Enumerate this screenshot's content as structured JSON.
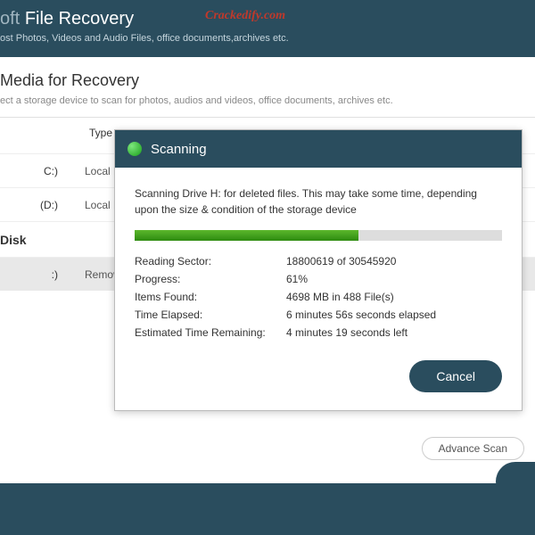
{
  "header": {
    "soft": "oft",
    "title": "File Recovery",
    "sub": "ost Photos, Videos and Audio Files, office documents,archives etc.",
    "watermark": "Crackedify.com"
  },
  "section": {
    "title": "Media for Recovery",
    "sub": "ect a storage device to scan for photos, audios and videos, office documents, archives etc."
  },
  "columns": {
    "type": "Type"
  },
  "drives": {
    "c_letter": "C:)",
    "c_type": "Local Disk",
    "d_letter": " (D:)",
    "d_type": "Local Disk",
    "group": "Disk",
    "h_letter": ":)",
    "h_type": "Removable"
  },
  "modal": {
    "title": "Scanning",
    "desc": "Scanning Drive H: for deleted files. This may take some time, depending upon the size & condition of the storage device",
    "progress_percent": 61,
    "stats": {
      "sector_label": "Reading Sector:",
      "sector_value": "18800619 of 30545920",
      "progress_label": "Progress:",
      "progress_value": "61%",
      "items_label": "Items Found:",
      "items_value": "4698 MB in 488 File(s)",
      "elapsed_label": "Time Elapsed:",
      "elapsed_value": "6 minutes 56s seconds elapsed",
      "remaining_label": "Estimated Time Remaining:",
      "remaining_value": "4 minutes 19 seconds left"
    },
    "cancel": "Cancel"
  },
  "advance_scan": "Advance Scan"
}
